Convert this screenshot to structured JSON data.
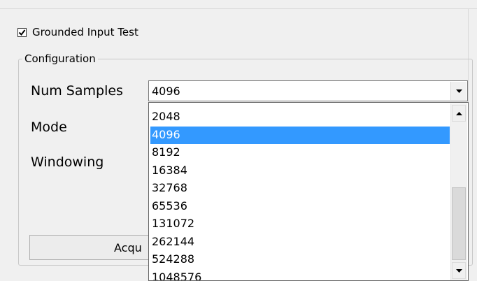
{
  "grounded_test": {
    "label": "Grounded Input Test",
    "checked": true
  },
  "configuration": {
    "title": "Configuration",
    "num_samples_label": "Num Samples",
    "mode_label": "Mode",
    "windowing_label": "Windowing",
    "num_samples_value": "4096"
  },
  "acquire_button": {
    "label": "Acqu"
  },
  "dropdown": {
    "options": [
      "2048",
      "4096",
      "8192",
      "16384",
      "32768",
      "65536",
      "131072",
      "262144",
      "524288",
      "1048576"
    ],
    "selected": "4096"
  },
  "icons": {
    "checkmark": "check-icon",
    "combo_arrow": "chevron-down-icon",
    "scroll_up": "chevron-up-icon",
    "scroll_down": "chevron-down-icon"
  },
  "colors": {
    "selection": "#3399ff",
    "background": "#f0f0f0"
  }
}
